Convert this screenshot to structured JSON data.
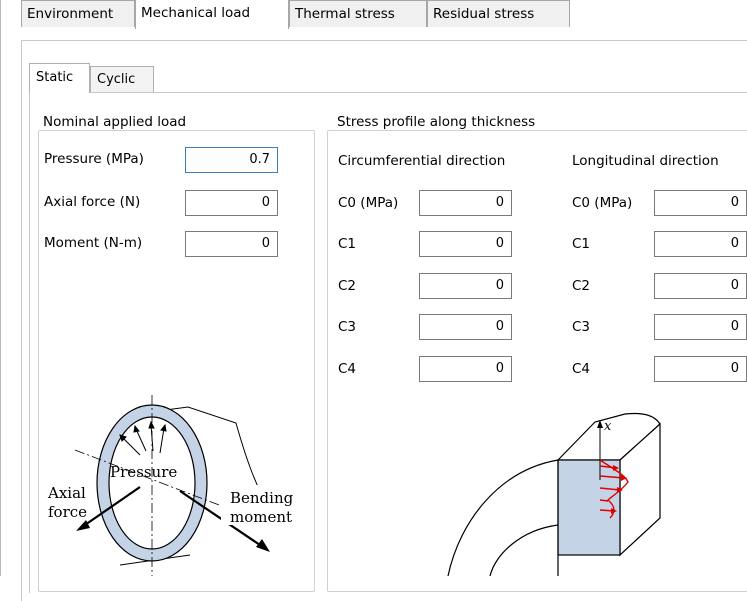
{
  "tabs": [
    "Environment",
    "Mechanical load",
    "Thermal stress",
    "Residual stress"
  ],
  "subtabs": [
    "Static",
    "Cyclic"
  ],
  "nominal": {
    "title": "Nominal applied load",
    "fields": [
      {
        "label": "Pressure (MPa)",
        "value": "0.7"
      },
      {
        "label": "Axial force (N)",
        "value": "0"
      },
      {
        "label": "Moment (N-m)",
        "value": "0"
      }
    ]
  },
  "profile": {
    "title": "Stress profile along thickness",
    "circ_title": "Circumferential direction",
    "long_title": "Longitudinal direction",
    "rows": [
      {
        "label": "C0 (MPa)",
        "circ": "0",
        "long": "0"
      },
      {
        "label": "C1",
        "circ": "0",
        "long": "0"
      },
      {
        "label": "C2",
        "circ": "0",
        "long": "0"
      },
      {
        "label": "C3",
        "circ": "0",
        "long": "0"
      },
      {
        "label": "C4",
        "circ": "0",
        "long": "0"
      }
    ]
  },
  "figure_labels": {
    "pressure": "Pressure",
    "axial1": "Axial",
    "axial2": "force",
    "bending1": "Bending",
    "bending2": "moment",
    "x_axis": "x"
  }
}
